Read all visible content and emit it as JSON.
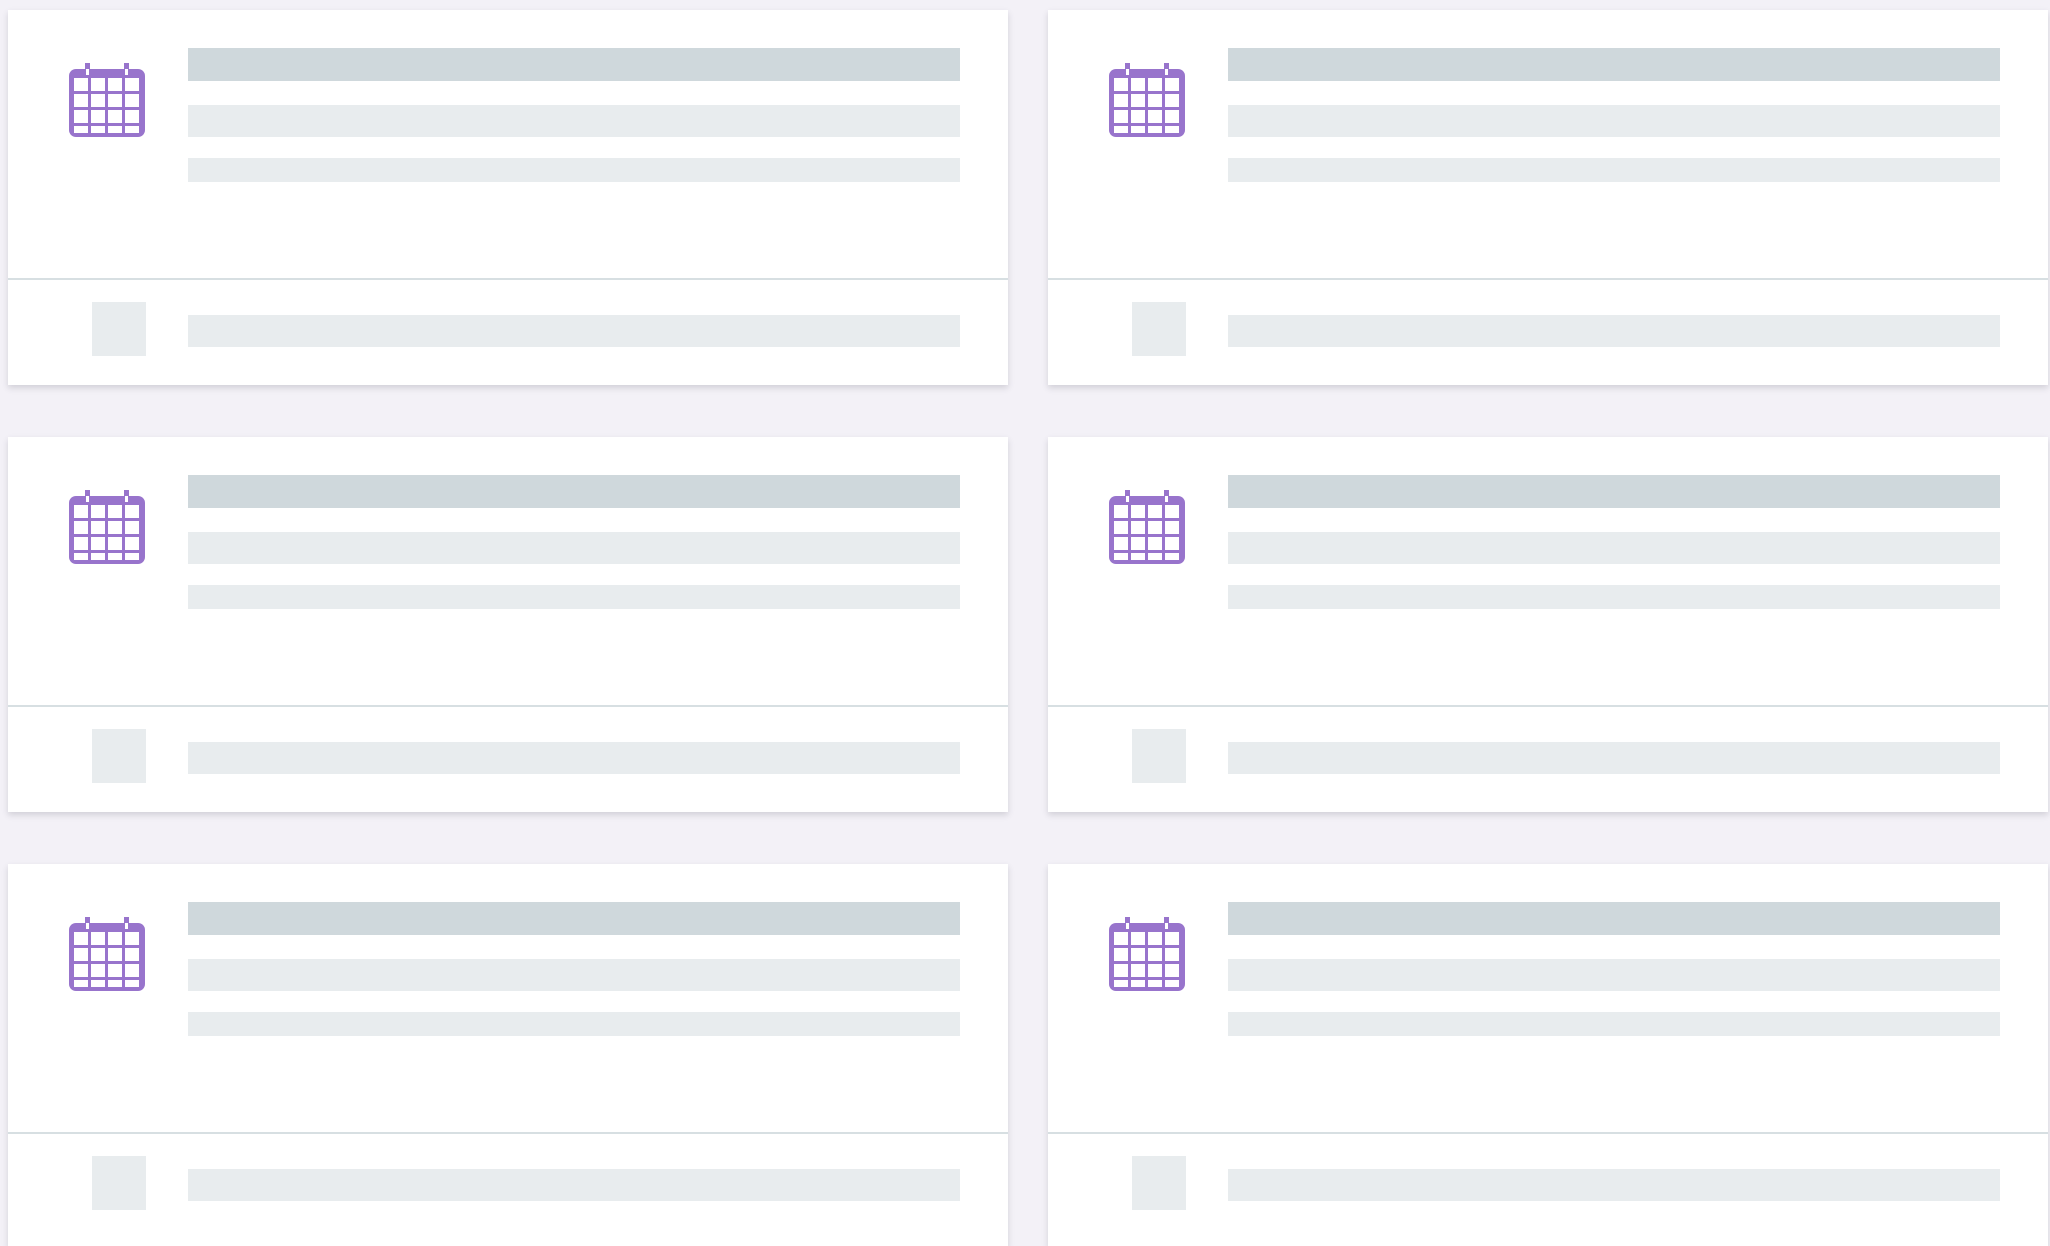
{
  "colors": {
    "background": "#f3f1f7",
    "card": "#ffffff",
    "accent_icon": "#9874cc",
    "placeholder_dark": "#cfd8dc",
    "placeholder_light": "#e8ecee",
    "divider": "#d7dfe2"
  },
  "cards": [
    {
      "icon": "calendar-icon",
      "state": "loading-skeleton"
    },
    {
      "icon": "calendar-icon",
      "state": "loading-skeleton"
    },
    {
      "icon": "calendar-icon",
      "state": "loading-skeleton"
    },
    {
      "icon": "calendar-icon",
      "state": "loading-skeleton"
    },
    {
      "icon": "calendar-icon",
      "state": "loading-skeleton"
    },
    {
      "icon": "calendar-icon",
      "state": "loading-skeleton"
    }
  ]
}
